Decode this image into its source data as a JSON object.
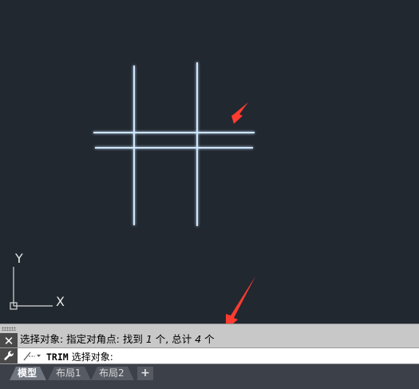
{
  "canvas": {
    "background": "#212830",
    "line_color": "#cfe6ff",
    "glow_color": "#3f8bff",
    "arrow_color": "#ff3b30",
    "ucs": {
      "y_label": "Y",
      "x_label": "X"
    }
  },
  "command": {
    "history_prefix": "选择对象: 指定对角点: 找到 ",
    "found_count": "1",
    "history_mid": " 个, 总计 ",
    "total_count": "4",
    "history_suffix": " 个",
    "current_command": "TRIM",
    "current_prompt": "选择对象:",
    "close_icon_glyph": "✕"
  },
  "tabs": [
    {
      "label": "模型",
      "active": true
    },
    {
      "label": "布局1",
      "active": false
    },
    {
      "label": "布局2",
      "active": false
    }
  ],
  "add_tab_glyph": "+"
}
